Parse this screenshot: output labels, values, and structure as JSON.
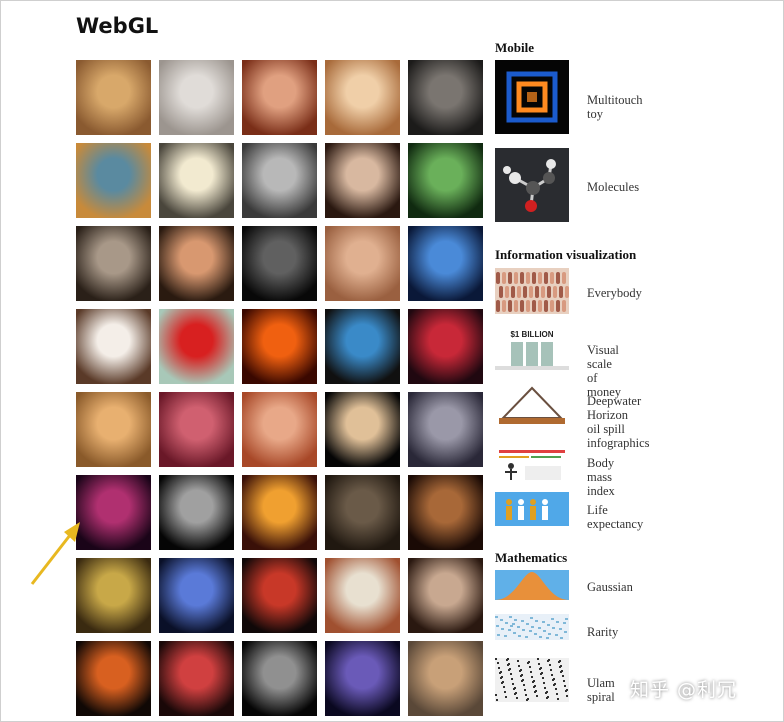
{
  "page": {
    "title": "WebGL"
  },
  "grid": {
    "thumbnails": [
      {
        "id": "venus",
        "colors": [
          "#d8a86a",
          "#8a5a30"
        ]
      },
      {
        "id": "woman-face-grey",
        "colors": [
          "#e0dcd8",
          "#9c958f"
        ]
      },
      {
        "id": "redhead-face",
        "colors": [
          "#e0a080",
          "#7a2e18"
        ]
      },
      {
        "id": "blonde-woman",
        "colors": [
          "#f0cfa8",
          "#a86a3a"
        ]
      },
      {
        "id": "man-face-dark",
        "colors": [
          "#7a7570",
          "#1c1b1a"
        ]
      },
      {
        "id": "van-gogh",
        "colors": [
          "#5a8aa0",
          "#c88a3a"
        ]
      },
      {
        "id": "sketch-portrait",
        "colors": [
          "#f2ead0",
          "#4a463c"
        ]
      },
      {
        "id": "einstein",
        "colors": [
          "#b8b8b8",
          "#3a3a3a"
        ]
      },
      {
        "id": "bald-head",
        "colors": [
          "#d8b8a0",
          "#2a1810"
        ]
      },
      {
        "id": "green-face",
        "colors": [
          "#6ab05a",
          "#102a10"
        ]
      },
      {
        "id": "dark-hair-woman",
        "colors": [
          "#a89888",
          "#2a2018"
        ]
      },
      {
        "id": "smiling-girl",
        "colors": [
          "#d89870",
          "#2a1a10"
        ]
      },
      {
        "id": "shadow-face",
        "colors": [
          "#606060",
          "#080808"
        ]
      },
      {
        "id": "angry-face",
        "colors": [
          "#e0b090",
          "#9a6040"
        ]
      },
      {
        "id": "blue-robot",
        "colors": [
          "#4a8ad8",
          "#0a1838"
        ]
      },
      {
        "id": "brunette-smile",
        "colors": [
          "#f4eee8",
          "#5a3a28"
        ]
      },
      {
        "id": "red-car",
        "colors": [
          "#d82020",
          "#a8c8b8"
        ]
      },
      {
        "id": "fire-silhouettes",
        "colors": [
          "#f06010",
          "#3a0800"
        ]
      },
      {
        "id": "earth-globe",
        "colors": [
          "#3a8ac8",
          "#101010"
        ]
      },
      {
        "id": "red-crowd",
        "colors": [
          "#c82838",
          "#200810"
        ]
      },
      {
        "id": "cat",
        "colors": [
          "#e8b070",
          "#8a5a2a"
        ]
      },
      {
        "id": "red-crystals",
        "colors": [
          "#d06070",
          "#6a1828"
        ]
      },
      {
        "id": "canyon-rock",
        "colors": [
          "#e8a888",
          "#a84828"
        ]
      },
      {
        "id": "jupiter",
        "colors": [
          "#e0c098",
          "#050505"
        ]
      },
      {
        "id": "dancer",
        "colors": [
          "#9a98a8",
          "#2a2838"
        ]
      },
      {
        "id": "purple-sphere",
        "colors": [
          "#b03070",
          "#1a0418"
        ]
      },
      {
        "id": "night-earth",
        "colors": [
          "#a0a0a0",
          "#050505"
        ]
      },
      {
        "id": "glowing-door",
        "colors": [
          "#f0a030",
          "#3a1008"
        ]
      },
      {
        "id": "warriors",
        "colors": [
          "#6a5a48",
          "#201810"
        ]
      },
      {
        "id": "warrior-close",
        "colors": [
          "#a86838",
          "#1a0a05"
        ]
      },
      {
        "id": "patterned-blocks",
        "colors": [
          "#c8a848",
          "#3a2a10"
        ]
      },
      {
        "id": "blue-stage",
        "colors": [
          "#5a7ad8",
          "#0a1028"
        ]
      },
      {
        "id": "red-soldier",
        "colors": [
          "#c83828",
          "#100808"
        ]
      },
      {
        "id": "cartoon-heroes",
        "colors": [
          "#e8e0d0",
          "#a05030"
        ]
      },
      {
        "id": "man-bust",
        "colors": [
          "#c8a890",
          "#2a1810"
        ]
      },
      {
        "id": "lava-rocks",
        "colors": [
          "#d86020",
          "#100805"
        ]
      },
      {
        "id": "red-robots",
        "colors": [
          "#d04040",
          "#1a0808"
        ]
      },
      {
        "id": "skull",
        "colors": [
          "#909090",
          "#050505"
        ]
      },
      {
        "id": "space-shuttle",
        "colors": [
          "#6a5ab8",
          "#0a0820"
        ]
      },
      {
        "id": "desert-truck",
        "colors": [
          "#c8a078",
          "#5a4838"
        ]
      }
    ]
  },
  "sidebar": {
    "mobile": {
      "title": "Mobile",
      "items": [
        {
          "label": "Multitouch toy",
          "icon": "glow-squares",
          "colors": [
            "#ff8a20",
            "#2070ff"
          ]
        },
        {
          "label": "Molecules",
          "icon": "molecule",
          "colors": [
            "#d02020",
            "#e8e8e8"
          ]
        }
      ]
    },
    "infovis": {
      "title": "Information visualization",
      "items": [
        {
          "label": "Everybody",
          "icon": "crowd",
          "colors": [
            "#d89a80",
            "#a05a48"
          ]
        },
        {
          "label": "Visual scale of money",
          "icon": "money-stacks",
          "badge": "$1 BILLION",
          "colors": [
            "#6a9a8a",
            "#222222"
          ]
        },
        {
          "label": "Deepwater Horizon\noil spill infographics",
          "icon": "pyramid",
          "colors": [
            "#b06a30",
            "#6a5040"
          ]
        },
        {
          "label": "Body mass index",
          "icon": "bmi-chart",
          "colors": [
            "#e04040",
            "#303030"
          ]
        },
        {
          "label": "Life expectancy",
          "icon": "people-figures",
          "colors": [
            "#50a8e8",
            "#e0a020"
          ]
        }
      ]
    },
    "math": {
      "title": "Mathematics",
      "items": [
        {
          "label": "Gaussian",
          "icon": "gaussian",
          "colors": [
            "#e8903a",
            "#60b0e8"
          ]
        },
        {
          "label": "Rarity",
          "icon": "rarity",
          "colors": [
            "#80b8d8",
            "#e8f0f8"
          ]
        },
        {
          "label": "Ulam spiral",
          "icon": "ulam",
          "colors": [
            "#303030",
            "#f0f0f0"
          ]
        }
      ]
    }
  },
  "watermark": "知乎 @利冗",
  "colors": {
    "accent": "#e8b820",
    "text": "#333333"
  }
}
